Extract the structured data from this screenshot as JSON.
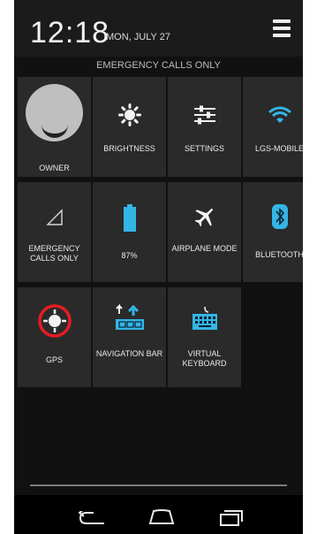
{
  "status": {
    "time": "12:18",
    "date": "MON, JULY 27",
    "emergency_text": "EMERGENCY CALLS ONLY"
  },
  "tiles": [
    {
      "label": "OWNER",
      "icon": "avatar-icon"
    },
    {
      "label": "BRIGHTNESS",
      "icon": "brightness-icon"
    },
    {
      "label": "SETTINGS",
      "icon": "settings-sliders-icon"
    },
    {
      "label": "LGS-MOBILE",
      "icon": "wifi-icon"
    },
    {
      "label": "EMERGENCY CALLS ONLY",
      "icon": "signal-icon"
    },
    {
      "label": "87%",
      "icon": "battery-icon"
    },
    {
      "label": "AIRPLANE MODE",
      "icon": "airplane-icon"
    },
    {
      "label": "BLUETOOTH",
      "icon": "bluetooth-icon"
    },
    {
      "label": "GPS",
      "icon": "gps-icon"
    },
    {
      "label": "NAVIGATION BAR",
      "icon": "navigation-bar-icon"
    },
    {
      "label": "VIRTUAL KEYBOARD",
      "icon": "keyboard-icon"
    }
  ],
  "colors": {
    "accent": "#33b5e5",
    "gps_ring": "#e51c23"
  }
}
